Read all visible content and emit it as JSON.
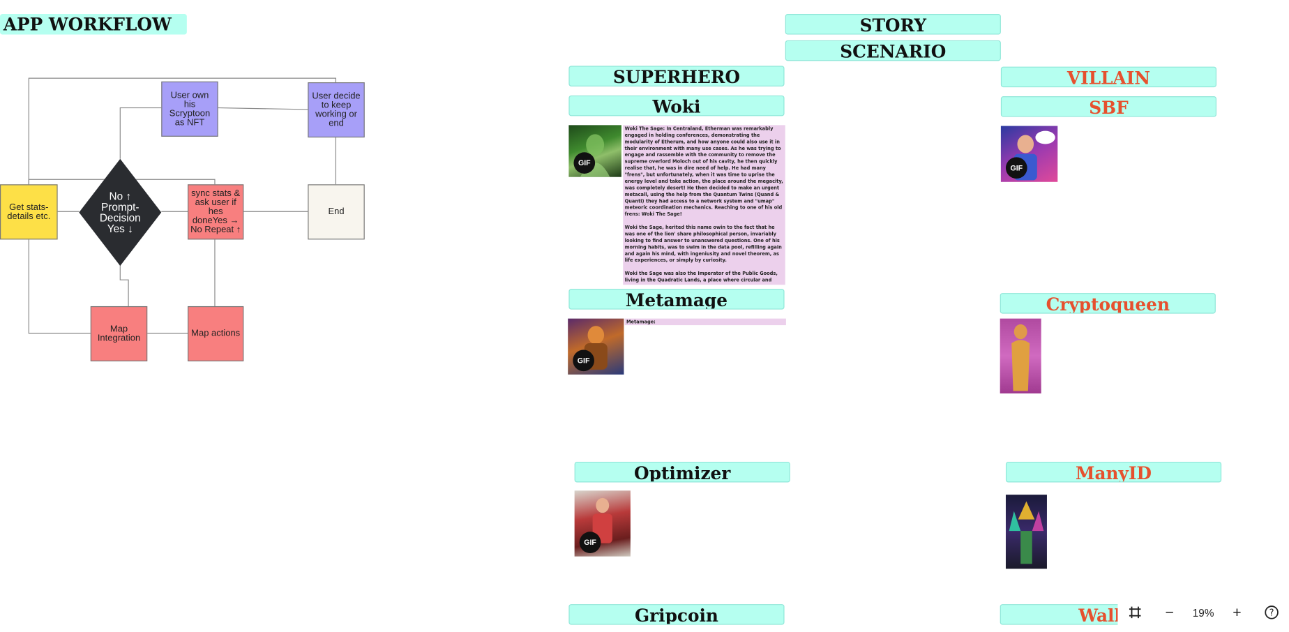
{
  "workflow": {
    "title": "APP WORKFLOW",
    "nodes": {
      "get_stats": "Get stats-details etc.",
      "decision": "No ↑\nPrompt-\nDecision\nYes ↓",
      "own_nft": "User own his Scryptoon as NFT",
      "sync_stats": "sync stats & ask user if hes doneYes → No Repeat ↑",
      "user_decide": "User decide to keep working or end",
      "end": "End",
      "map_integration": "Map Integration",
      "map_actions": "Map actions"
    },
    "colors": {
      "yellow": "#fde047",
      "purple": "#a79ff8",
      "red": "#f87f7f",
      "end": "#f8f5ee",
      "diamond": "#2a2c30"
    }
  },
  "headers": {
    "story": "STORY",
    "scenario": "SCENARIO",
    "superhero": "SUPERHERO",
    "villain": "VILLAIN"
  },
  "characters": {
    "heroes": [
      {
        "name": "Woki",
        "gif": "GIF"
      },
      {
        "name": "Metamage",
        "gif": "GIF"
      },
      {
        "name": "Optimizer",
        "gif": "GIF"
      },
      {
        "name": "Gripcoin"
      }
    ],
    "villains": [
      {
        "name": "SBF",
        "gif": "GIF"
      },
      {
        "name": "Cryptoqueen"
      },
      {
        "name": "ManyID"
      },
      {
        "name": "WallH"
      }
    ]
  },
  "woki_story": [
    "Woki The Sage: In Centraland, Etherman was remarkably engaged in holding conferences, demonstrating the modularity of Etherum, and how anyone could also use it in their environment with many use cases. As he was trying to engage and rassemble with the community to remove the supreme overlord Moloch out of his cavity, he then quickly realise that, he was in dire need of help. He had many \"frens\", but unfortunately, when it was time to uprise the energy level and take action, the place around the megacity, was completely desert! He then decided to make an urgent metacall, using the help from the Quantum Twins (Quand & Quanti) they had access to a network system and \"umap\" meteoric coordination mechanics. Reaching to one of his old frens: Woki The Sage!",
    "Woki the Sage, herited this name owin to the fact that he was one of the lion' share philosophical person, invariably looking to find answer to unanswered questions. One of his morning habits, was to swim in the data pool, refilling again and again his mind, with ingeniusity and novel theorem, as life experiences, or simply by curiosity.",
    "Woki the Sage was also the Imperator of the Public Goods, living in the Quadratic Lands, a place where circular and regenerative cryptoeconomics, and capital allocation for the community, was abondant!"
  ],
  "metamage_story": "Metamage:",
  "toolbar": {
    "zoom": "19%",
    "icons": [
      "fit-to-screen-icon",
      "zoom-out-icon",
      "zoom-in-icon",
      "help-icon"
    ]
  }
}
